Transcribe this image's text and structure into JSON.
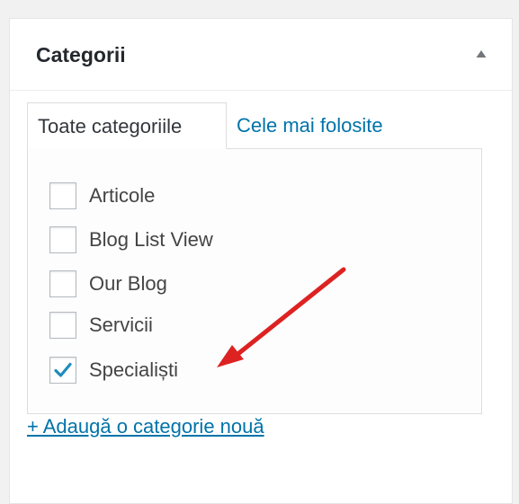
{
  "postbox": {
    "title": "Categorii",
    "toggle_icon": "triangle-up-icon"
  },
  "tabs": [
    {
      "label": "Toate categoriile",
      "active": true
    },
    {
      "label": "Cele mai folosite",
      "active": false
    }
  ],
  "categories": [
    {
      "label": "Articole",
      "checked": false
    },
    {
      "label": "Blog List View",
      "checked": false
    },
    {
      "label": "Our Blog",
      "checked": false
    },
    {
      "label": "Servicii",
      "checked": false
    },
    {
      "label": "Specialiști",
      "checked": true
    }
  ],
  "add_category_link": "+ Adaugă o categorie nouă",
  "colors": {
    "link": "#0073aa",
    "checkmark": "#1e8cbe",
    "annotation_arrow": "#dd2222"
  }
}
